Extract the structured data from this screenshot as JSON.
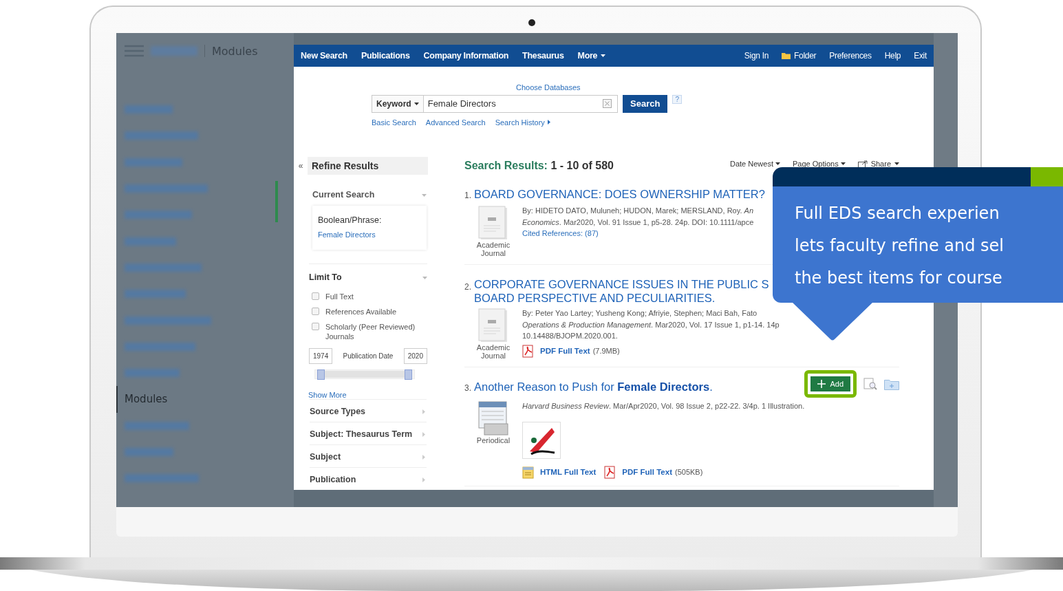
{
  "sidebar": {
    "header": {
      "title": "Modules"
    },
    "items": [
      {
        "kind": "blurred",
        "selected": false
      },
      {
        "kind": "blurred",
        "selected": false
      },
      {
        "kind": "blurred",
        "selected": false
      },
      {
        "kind": "blurred",
        "selected": false
      },
      {
        "kind": "blurred",
        "selected": false
      },
      {
        "kind": "blurred",
        "selected": false
      },
      {
        "kind": "blurred",
        "selected": false
      },
      {
        "kind": "blurred",
        "selected": false
      },
      {
        "kind": "blurred",
        "selected": false
      },
      {
        "kind": "blurred",
        "selected": false
      },
      {
        "kind": "blurred",
        "selected": false
      },
      {
        "kind": "label",
        "label": "Modules",
        "selected": true
      },
      {
        "kind": "blurred",
        "selected": false
      },
      {
        "kind": "blurred",
        "selected": false
      },
      {
        "kind": "blurred",
        "selected": false
      }
    ]
  },
  "toolbar": {
    "left": [
      {
        "label": "New Search",
        "kind": "link"
      },
      {
        "label": "Publications",
        "kind": "link"
      },
      {
        "label": "Company Information",
        "kind": "link"
      },
      {
        "label": "Thesaurus",
        "kind": "link"
      },
      {
        "label": "More",
        "kind": "menu"
      }
    ],
    "right": [
      {
        "label": "Sign In",
        "kind": "link"
      },
      {
        "label": "Folder",
        "kind": "folder"
      },
      {
        "label": "Preferences",
        "kind": "link"
      },
      {
        "label": "Help",
        "kind": "link"
      },
      {
        "label": "Exit",
        "kind": "link"
      }
    ]
  },
  "search": {
    "choose_databases": "Choose Databases",
    "field_type": "Keyword",
    "value": "Female Directors",
    "button": "Search",
    "help": "?",
    "links": [
      {
        "label": "Basic Search",
        "kind": "link"
      },
      {
        "label": "Advanced Search",
        "kind": "link"
      },
      {
        "label": "Search History",
        "kind": "menu"
      }
    ]
  },
  "refine": {
    "collapse": "«",
    "title": "Refine Results",
    "current_search": {
      "title": "Current Search",
      "expanded": true,
      "label": "Boolean/Phrase:",
      "term": "Female Directors"
    },
    "limit_to": {
      "title": "Limit To",
      "expanded": true,
      "options": [
        {
          "label": "Full Text",
          "checked": false
        },
        {
          "label": "References Available",
          "checked": false
        },
        {
          "label": "Scholarly (Peer Reviewed) Journals",
          "checked": false
        }
      ],
      "date_from": "1974",
      "date_label": "Publication Date",
      "date_to": "2020",
      "date_range": {
        "level": 1
      },
      "show_more": "Show More"
    },
    "facets": [
      {
        "title": "Source Types",
        "expanded": false
      },
      {
        "title": "Subject: Thesaurus Term",
        "expanded": false
      },
      {
        "title": "Subject",
        "expanded": false
      },
      {
        "title": "Publication",
        "expanded": false
      }
    ]
  },
  "results": {
    "label": "Search Results:",
    "range": "1 - 10 of 580",
    "sort": "Date Newest",
    "page_options": "Page Options",
    "share": "Share",
    "items": [
      {
        "number": "1.",
        "title": "BOARD GOVERNANCE: DOES OWNERSHIP MATTER?",
        "type": "Academic Journal",
        "kind": "journal",
        "details": [
          "By: HIDETO DATO, Muluneh; HUDON, Marek; MERSLAND, Roy. *An*",
          "*Economics*. Mar2020, Vol. 91 Issue 1, p5-28. 24p. DOI: 10.1111/apce"
        ],
        "cited": "Cited References: (87)"
      },
      {
        "number": "2.",
        "title": "CORPORATE GOVERNANCE ISSUES IN THE PUBLIC S\nBOARD PERSPECTIVE AND PECULIARITIES.",
        "type": "Academic Journal",
        "kind": "journal",
        "details": [
          "By: Peter Yao Lartey; Yusheng Kong; Afriyie, Stephen; Maci Bah, Fato",
          "*Operations & Production Management*. Mar2020, Vol. 17 Issue 1, p1-14. 14p",
          "10.14488/BJOPM.2020.001."
        ],
        "links": [
          {
            "kind": "pdf",
            "label": "PDF Full Text",
            "size": "(7.9MB)"
          }
        ]
      },
      {
        "number": "3.",
        "title": "Another Reason to Push for **Female Directors**.",
        "type": "Periodical",
        "kind": "periodical",
        "details": [
          "*Harvard Business Review*. Mar/Apr2020, Vol. 98 Issue 2, p22-22. 3/4p. 1 Illustration."
        ],
        "cover": true,
        "add": "Add",
        "links": [
          {
            "kind": "html",
            "label": "HTML Full Text"
          },
          {
            "kind": "pdf",
            "label": "PDF Full Text",
            "size": "(505KB)"
          }
        ]
      }
    ]
  },
  "callout": {
    "lines": [
      "Full EDS search experien",
      "lets faculty refine and sel",
      "the best items for course"
    ]
  }
}
